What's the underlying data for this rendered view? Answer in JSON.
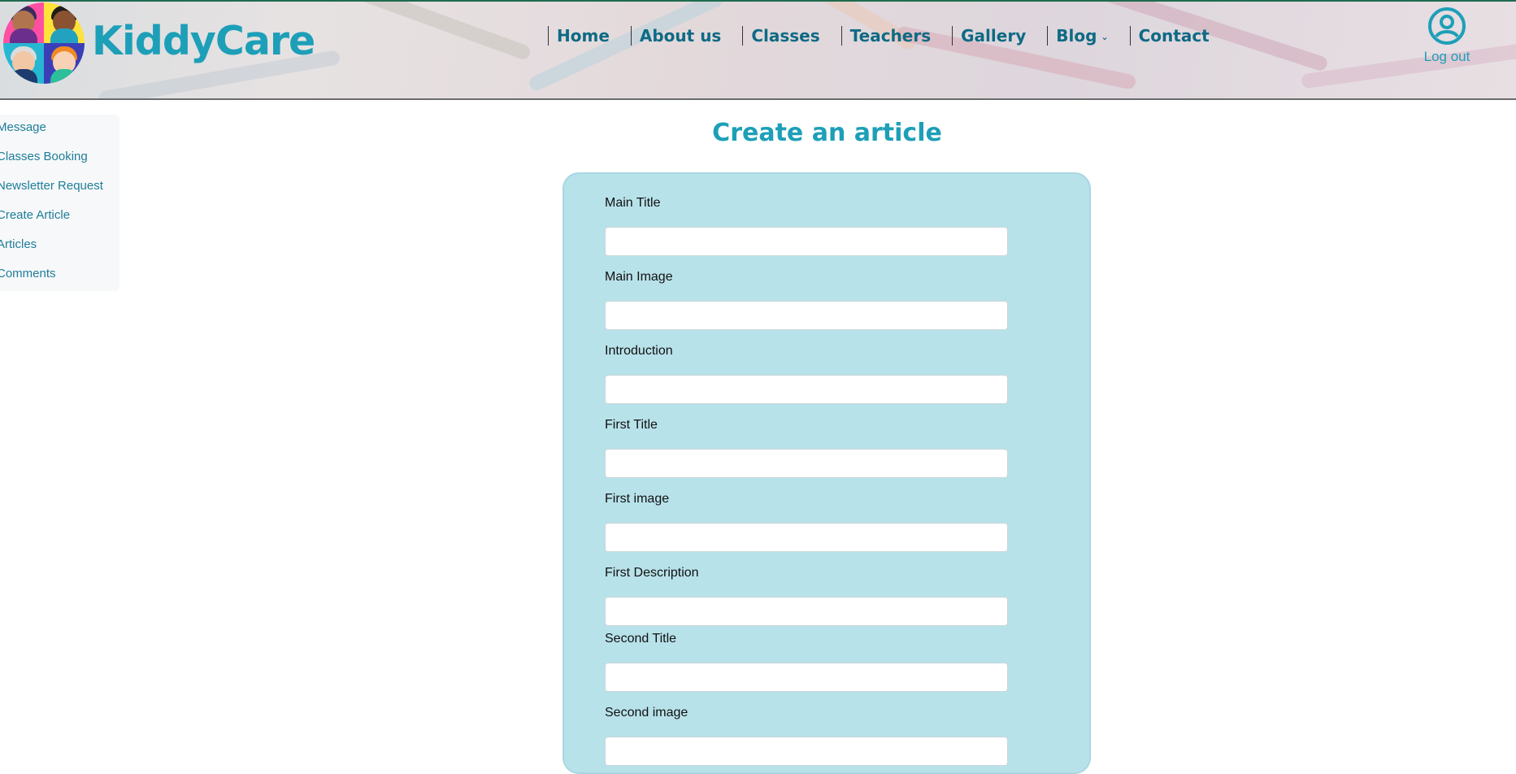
{
  "app": {
    "brand": "KiddyCare",
    "logo_icon": "kids-faces-logo-icon"
  },
  "nav": {
    "items": [
      {
        "label": "Home"
      },
      {
        "label": "About us"
      },
      {
        "label": "Classes"
      },
      {
        "label": "Teachers"
      },
      {
        "label": "Gallery"
      },
      {
        "label": "Blog",
        "has_dropdown": true
      },
      {
        "label": "Contact"
      }
    ],
    "dropdown_icon": "chevron-down-icon"
  },
  "account": {
    "icon": "user-circle-icon",
    "logout_label": "Log out"
  },
  "sidebar": {
    "items": [
      {
        "label": "Message"
      },
      {
        "label": "Classes Booking"
      },
      {
        "label": "Newsletter Request"
      },
      {
        "label": "Create Article"
      },
      {
        "label": "Articles"
      },
      {
        "label": "Comments"
      }
    ]
  },
  "main": {
    "title": "Create an article",
    "fields": [
      {
        "label": "Main Title",
        "value": ""
      },
      {
        "label": "Main Image",
        "value": ""
      },
      {
        "label": "Introduction",
        "value": ""
      },
      {
        "label": "First Title",
        "value": ""
      },
      {
        "label": "First image",
        "value": ""
      },
      {
        "label": "First Description",
        "value": ""
      },
      {
        "label": "Second Title",
        "value": ""
      },
      {
        "label": "Second image",
        "value": ""
      }
    ]
  },
  "colors": {
    "brand": "#1d9fb8",
    "nav_text": "#0e6a84",
    "form_background": "#b8e2ea",
    "sidebar_background": "#f6f8fa"
  }
}
